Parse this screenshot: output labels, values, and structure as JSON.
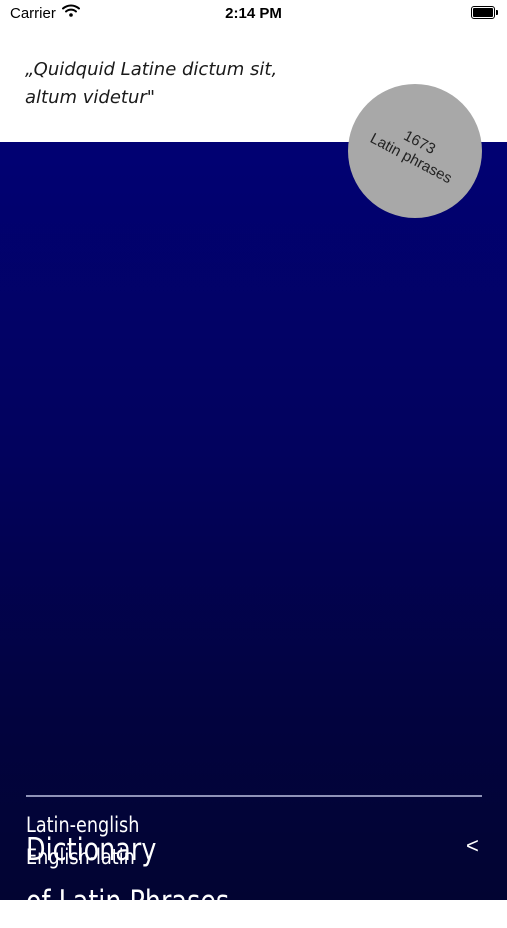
{
  "status_bar": {
    "carrier": "Carrier",
    "time": "2:14 PM"
  },
  "quote": {
    "line1": "„Quidquid Latine dictum sit,",
    "line2": "altum videtur\""
  },
  "badge": {
    "count": "1673",
    "label": "Latin phrases"
  },
  "title": {
    "line1": "Dictionary",
    "line2": "of Latin Phrases"
  },
  "links": {
    "latin_english": "Latin-english",
    "english_latin": "English-latin"
  },
  "chevron": "<",
  "colors": {
    "hero_top": "#010173",
    "hero_bottom": "#020432",
    "badge": "#a8a8a8"
  }
}
